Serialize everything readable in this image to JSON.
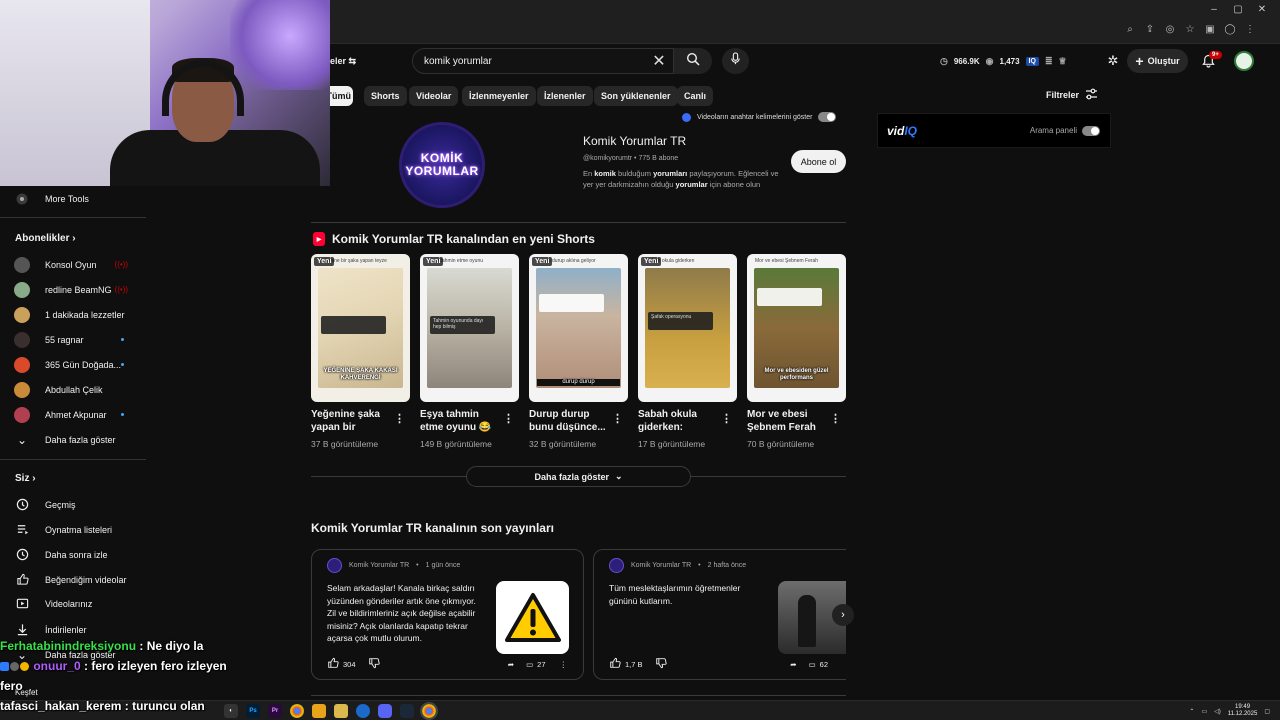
{
  "browser": {
    "window_controls": [
      "–",
      "▢",
      "✕"
    ],
    "toolbar_icons": [
      "search-icon",
      "share-icon",
      "eye-off-icon",
      "star-icon",
      "extensions-icon",
      "profile-icon",
      "menu-icon"
    ]
  },
  "header": {
    "partial_label": "eler",
    "search": {
      "value": "komik yorumlar"
    },
    "stats": {
      "views": "966.9K",
      "watching": "1,473"
    },
    "create_label": "Oluştur",
    "notifications_badge": "9+"
  },
  "chips": [
    "Tümü",
    "Shorts",
    "Videolar",
    "İzlenmeyenler",
    "İzlenenler",
    "Son yüklenenler",
    "Canlı"
  ],
  "filters_label": "Filtreler",
  "keywords_toggle_label": "Videoların anahtar kelimelerini göster",
  "vidiq": {
    "logo_a": "vid",
    "logo_b": "IQ",
    "panel_label": "Arama paneli"
  },
  "channel": {
    "avatar_line1": "KOMİK",
    "avatar_line2": "YORUMLAR",
    "name": "Komik Yorumlar TR",
    "meta": "@komikyorumtr • 775 B abone",
    "desc_1": "En ",
    "desc_b1": "komik",
    "desc_2": " bulduğum ",
    "desc_b2": "yorumları",
    "desc_3": " paylaşıyorum. Eğlenceli ve yer yer darkmizahın olduğu ",
    "desc_b3": "yorumlar",
    "desc_4": " için abone olun",
    "subscribe_label": "Abone ol"
  },
  "shorts": {
    "section_title": "Komik Yorumlar TR kanalından en yeni Shorts",
    "new_label": "Yeni",
    "items": [
      {
        "title": "Yeğenine şaka yapan bir teyze...",
        "views": "37 B görüntüleme",
        "caption": "Yeğenine bir şaka yapan teyze",
        "comment": "",
        "overlay": "YEĞENİNE ŞAKA KAKASI KAHVERENGİ"
      },
      {
        "title": "Eşya tahmin etme oyunu 😂 ...",
        "views": "149 B görüntüleme",
        "caption": "Eşya tahmin etme oyunu",
        "comment": "Tahmin oyununda dayı hep bilmiş",
        "overlay": ""
      },
      {
        "title": "Durup durup bunu düşünce...",
        "views": "32 B görüntüleme",
        "caption": "Durup durup aklına geliyor",
        "comment": "",
        "overlay": "durup durup"
      },
      {
        "title": "Sabah okula giderken:",
        "views": "17 B görüntüleme",
        "caption": "Sabah okula giderken",
        "comment": "Şafak operasyonu",
        "overlay": ""
      },
      {
        "title": "Mor ve ebesi Şebnem Ferah ...",
        "views": "70 B görüntüleme",
        "caption": "Mor ve ebesi Şebnem Ferah",
        "comment": "",
        "overlay": "Mor ve ebesiden güzel performans"
      }
    ],
    "more_label": "Daha fazla göster"
  },
  "posts": {
    "section_title": "Komik Yorumlar TR kanalının son yayınları",
    "items": [
      {
        "author": "Komik Yorumlar TR",
        "time": "1 gün önce",
        "text": "Selam arkadaşlar! Kanala birkaç saldırı yüzünden gönderiler artık öne çıkmıyor. Zil ve bildirimleriniz açık değilse açabilir misiniz? Açık olanlarda kapatıp tekrar açarsa çok mutlu olurum.",
        "likes": "304",
        "comments": "27"
      },
      {
        "author": "Komik Yorumlar TR",
        "time": "2 hafta önce",
        "text": "Tüm meslektaşlarımın öğretmenler gününü kutlarım.",
        "likes": "1,7 B",
        "comments": "62"
      }
    ]
  },
  "sidebar": {
    "more_tools": "More Tools",
    "subscriptions_title": "Abonelikler",
    "subscriptions": [
      {
        "name": "Konsol Oyun",
        "indicator": "live",
        "color": "#555"
      },
      {
        "name": "redline BeamNG",
        "indicator": "live",
        "color": "#8a8"
      },
      {
        "name": "1 dakikada lezzetler",
        "indicator": "",
        "color": "#c9a15a"
      },
      {
        "name": "55 ragnar",
        "indicator": "dot",
        "color": "#3a2f2f"
      },
      {
        "name": "365 Gün Doğada...",
        "indicator": "dot",
        "color": "#d84a2a"
      },
      {
        "name": "Abdullah Çelik",
        "indicator": "",
        "color": "#c98a3a"
      },
      {
        "name": "Ahmet Akpunar",
        "indicator": "dot",
        "color": "#b04050"
      }
    ],
    "show_more": "Daha fazla göster",
    "you_title": "Siz",
    "you_items": [
      "Geçmiş",
      "Oynatma listeleri",
      "Daha sonra izle",
      "Beğendiğim videolar",
      "Videolarınız",
      "İndirilenler"
    ],
    "you_show_more": "Daha fazla göster",
    "explore": "Keşfet"
  },
  "chat": [
    {
      "user": "Ferhatabinindreksiyonu",
      "message": ": Ne diyo la"
    },
    {
      "user": "onuur_0",
      "message": ": fero izleyen fero izleyen fero"
    },
    {
      "user": "tafasci_hakan_kerem",
      "message": ": turuncu olan"
    }
  ],
  "taskbar": {
    "icons": [
      "Ps",
      "Pr",
      "chrome-icon",
      "folder-icon",
      "files-icon",
      "steam-icon",
      "discord-icon",
      "steam-icon-2",
      "chrome-icon-2"
    ],
    "time": "19:49",
    "date": "11.12.2025"
  }
}
